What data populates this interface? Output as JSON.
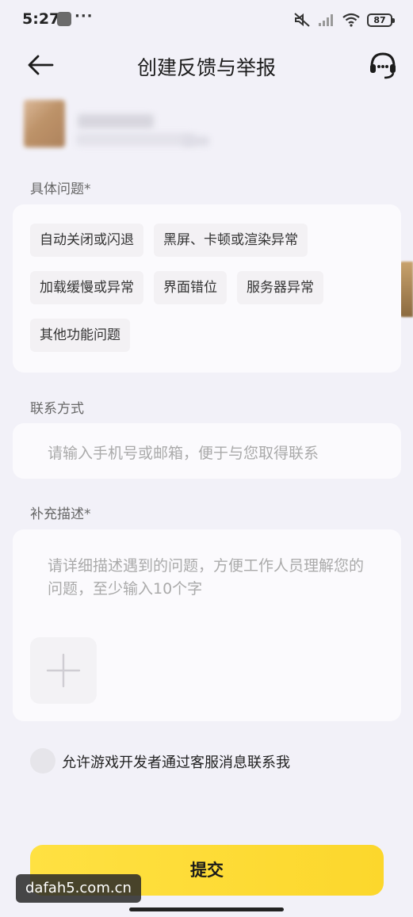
{
  "status_bar": {
    "time": "5:27",
    "dots": "···",
    "battery": "87"
  },
  "header": {
    "title": "创建反馈与举报"
  },
  "problem_section": {
    "label": "具体问题*",
    "options": [
      "自动关闭或闪退",
      "黑屏、卡顿或渲染异常",
      "加载缓慢或异常",
      "界面错位",
      "服务器异常",
      "其他功能问题"
    ]
  },
  "contact_section": {
    "label": "联系方式",
    "placeholder": "请输入手机号或邮箱，便于与您取得联系"
  },
  "description_section": {
    "label": "补充描述*",
    "placeholder": "请详细描述遇到的问题，方便工作人员理解您的问题，至少输入10个字"
  },
  "consent": {
    "label": "允许游戏开发者通过客服消息联系我"
  },
  "submit": {
    "label": "提交"
  },
  "watermark": "dafah5.com.cn",
  "colors": {
    "background": "#f2f1f8",
    "card": "#fbfafd",
    "chip": "#f3f1f4",
    "accent": "#fcd72c"
  }
}
